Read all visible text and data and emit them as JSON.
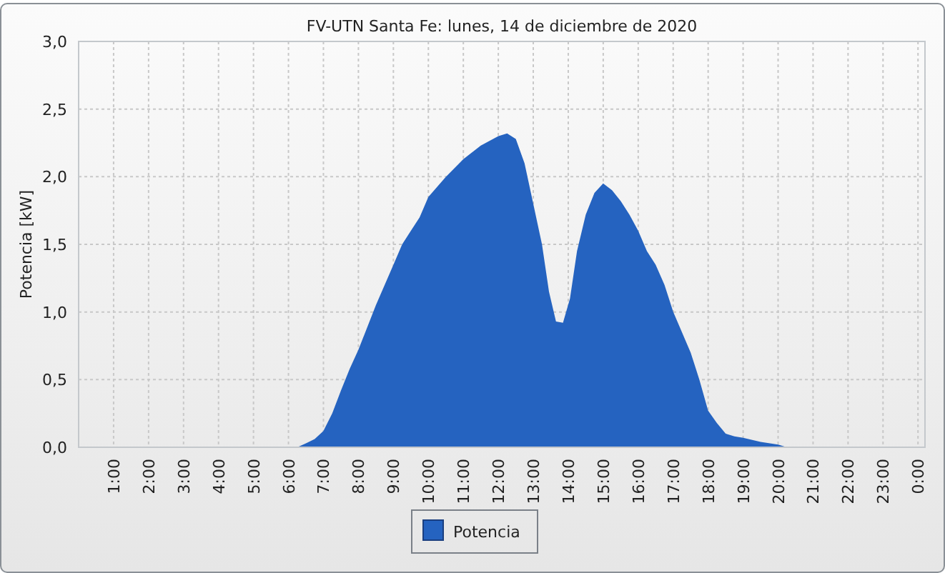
{
  "chart_data": {
    "type": "area",
    "title": "FV-UTN Santa Fe: lunes, 14 de diciembre de 2020",
    "ylabel": "Potencia [kW]",
    "x": [
      6.25,
      6.5,
      6.75,
      7.0,
      7.25,
      7.5,
      7.75,
      8.0,
      8.5,
      9.0,
      9.25,
      9.5,
      9.75,
      10.0,
      10.5,
      11.0,
      11.5,
      12.0,
      12.25,
      12.5,
      12.75,
      13.0,
      13.25,
      13.45,
      13.65,
      13.85,
      14.05,
      14.25,
      14.5,
      14.75,
      15.0,
      15.25,
      15.5,
      15.75,
      16.0,
      16.25,
      16.5,
      16.75,
      17.0,
      17.25,
      17.5,
      17.75,
      18.0,
      18.25,
      18.5,
      18.75,
      19.0,
      19.5,
      20.0,
      20.25
    ],
    "series": [
      {
        "name": "Potencia",
        "color": "#2563c0",
        "values": [
          0.0,
          0.03,
          0.06,
          0.12,
          0.25,
          0.42,
          0.58,
          0.72,
          1.05,
          1.35,
          1.5,
          1.6,
          1.7,
          1.85,
          2.0,
          2.13,
          2.23,
          2.3,
          2.32,
          2.28,
          2.1,
          1.8,
          1.5,
          1.15,
          0.93,
          0.92,
          1.1,
          1.45,
          1.72,
          1.88,
          1.95,
          1.9,
          1.82,
          1.72,
          1.6,
          1.45,
          1.35,
          1.2,
          1.0,
          0.85,
          0.7,
          0.5,
          0.27,
          0.18,
          0.1,
          0.08,
          0.07,
          0.04,
          0.02,
          0.0
        ]
      }
    ],
    "grid": true,
    "xlim": [
      0,
      24.2
    ],
    "ylim": [
      0,
      3
    ],
    "xticks": [
      {
        "value": 1,
        "label": "1:00"
      },
      {
        "value": 2,
        "label": "2:00"
      },
      {
        "value": 3,
        "label": "3:00"
      },
      {
        "value": 4,
        "label": "4:00"
      },
      {
        "value": 5,
        "label": "5:00"
      },
      {
        "value": 6,
        "label": "6:00"
      },
      {
        "value": 7,
        "label": "7:00"
      },
      {
        "value": 8,
        "label": "8:00"
      },
      {
        "value": 9,
        "label": "9:00"
      },
      {
        "value": 10,
        "label": "10:00"
      },
      {
        "value": 11,
        "label": "11:00"
      },
      {
        "value": 12,
        "label": "12:00"
      },
      {
        "value": 13,
        "label": "13:00"
      },
      {
        "value": 14,
        "label": "14:00"
      },
      {
        "value": 15,
        "label": "15:00"
      },
      {
        "value": 16,
        "label": "16:00"
      },
      {
        "value": 17,
        "label": "17:00"
      },
      {
        "value": 18,
        "label": "18:00"
      },
      {
        "value": 19,
        "label": "19:00"
      },
      {
        "value": 20,
        "label": "20:00"
      },
      {
        "value": 21,
        "label": "21:00"
      },
      {
        "value": 22,
        "label": "22:00"
      },
      {
        "value": 23,
        "label": "23:00"
      },
      {
        "value": 24,
        "label": "0:00"
      }
    ],
    "yticks": [
      {
        "value": 0,
        "label": "0,0"
      },
      {
        "value": 0.5,
        "label": "0,5"
      },
      {
        "value": 1,
        "label": "1,0"
      },
      {
        "value": 1.5,
        "label": "1,5"
      },
      {
        "value": 2,
        "label": "2,0"
      },
      {
        "value": 2.5,
        "label": "2,5"
      },
      {
        "value": 3,
        "label": "3,0"
      }
    ]
  }
}
